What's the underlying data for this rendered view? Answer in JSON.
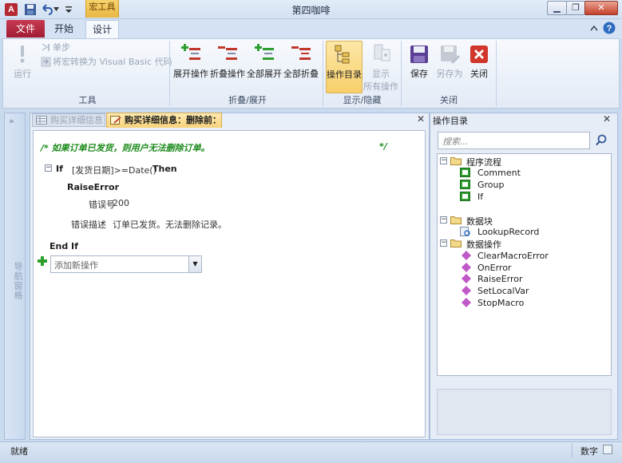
{
  "window": {
    "title": "第四咖啡",
    "contextual_tab": "宏工具"
  },
  "ribbon_tabs": {
    "file": "文件",
    "home": "开始",
    "design": "设计"
  },
  "ribbon": {
    "tools": {
      "run": "运行",
      "single_step": "单步",
      "convert": "将宏转换为 Visual Basic 代码",
      "label": "工具"
    },
    "collapse_expand": {
      "expand_action": "展开操作",
      "collapse_action": "折叠操作",
      "expand_all": "全部展开",
      "collapse_all": "全部折叠",
      "label": "折叠/展开"
    },
    "show_hide": {
      "action_catalog": "操作目录",
      "show_all_line1": "显示",
      "show_all_line2": "所有操作",
      "label": "显示/隐藏"
    },
    "close": {
      "save": "保存",
      "save_as": "另存为",
      "close": "关闭",
      "label": "关闭"
    }
  },
  "nav": {
    "chevron": "»",
    "label": "导航窗格"
  },
  "document_tabs": {
    "tab1": "购买详细信息",
    "tab2": "购买详细信息：删除前："
  },
  "editor": {
    "comment": "/*    如果订单已发货，则用户无法删除订单。",
    "comment_end": "*/",
    "if_kw": "If",
    "if_condition": "[发货日期]>=Date()",
    "then_kw": "Then",
    "action": "RaiseError",
    "arg1_label": "错误号",
    "arg1_value": "200",
    "arg2_label": "错误描述",
    "arg2_value": "订单已发货。无法删除记录。",
    "end_if": "End If",
    "add_action_placeholder": "添加新操作"
  },
  "catalog": {
    "title": "操作目录",
    "search_placeholder": "搜索...",
    "groups": [
      {
        "label": "程序流程",
        "items": [
          "Comment",
          "Group",
          "If"
        ]
      },
      {
        "label": "数据块",
        "items": [
          "LookupRecord"
        ]
      },
      {
        "label": "数据操作",
        "items": [
          "ClearMacroError",
          "OnError",
          "RaiseError",
          "SetLocalVar",
          "StopMacro"
        ]
      }
    ]
  },
  "status": {
    "left": "就绪",
    "right": "数字"
  },
  "colors": {
    "accent": "#f7d27a",
    "file_tab": "#b3263e",
    "comment_green": "#1a8a1a",
    "ribbon_bg": "#e3ebf6"
  }
}
